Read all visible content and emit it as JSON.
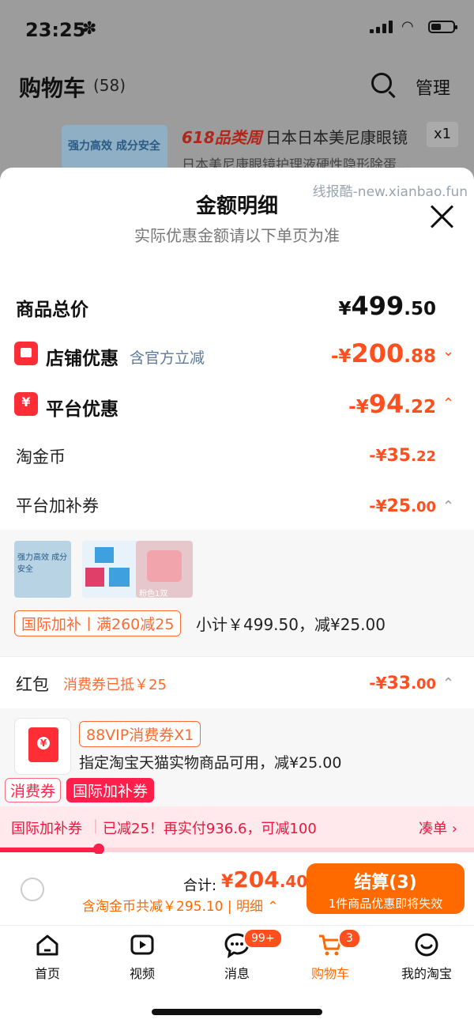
{
  "status": {
    "time": "23:25",
    "flower_icon": "✽"
  },
  "background_page": {
    "title": "购物车",
    "count": "(58)",
    "manage_label": "管理",
    "item_promo": "618品类周",
    "item_name": "日本日本美尼康眼镜",
    "item_name2": "日本美尼康眼镜护理液硬性隐形除蛋...",
    "item_qty": "x1",
    "thumb_text": "强力高效 成分安全"
  },
  "sheet": {
    "watermark": "线报酷-new.xianbao.fun",
    "title": "金额明细",
    "subtitle": "实际优惠金额请以下单页为准",
    "total": {
      "label": "商品总价",
      "currency": "¥",
      "int": "499",
      "dec": ".50"
    },
    "shop_discount": {
      "label": "店铺优惠",
      "note": "含官方立减",
      "prefix": "-¥",
      "int": "200",
      "dec": ".88"
    },
    "platform_discount": {
      "label": "平台优惠",
      "prefix": "-¥",
      "int": "94",
      "dec": ".22"
    },
    "taojinbi": {
      "label": "淘金币",
      "prefix": "-¥",
      "int": "35",
      "dec": ".22"
    },
    "platform_coupon": {
      "label": "平台加补券",
      "prefix": "-¥",
      "int": "25",
      "dec": ".00"
    },
    "thumbs": {
      "t1_text": "强力高效 成分安全",
      "t3_text": "粉色1双"
    },
    "coupon_tag": "国际加补丨满260减25",
    "coupon_subtotal": "小计￥499.50，减¥25.00",
    "red_packet": {
      "label": "红包",
      "note": "消费券已抵￥25",
      "prefix": "-¥",
      "int": "33",
      "dec": ".00"
    },
    "voucher": {
      "tag": "88VIP消费券X1",
      "desc": "指定淘宝天猫实物商品可用，减¥25.00",
      "pill1": "消费券",
      "pill2": "国际加补券"
    },
    "promo_bar": {
      "left": "国际加补券",
      "mid": "已减25！再实付936.6，可减100",
      "right": "凑单",
      "progress_pct": 21
    }
  },
  "checkout": {
    "total_label": "合计:",
    "currency": "¥",
    "total_int": "204",
    "total_dec": ".40",
    "discount_note": "含淘金币共减￥295.10 | 明细",
    "btn_label": "结算(3)",
    "btn_sub": "1件商品优惠即将失效"
  },
  "tabs": [
    {
      "label": "首页",
      "icon": "home-icon"
    },
    {
      "label": "视频",
      "icon": "video-icon"
    },
    {
      "label": "消息",
      "icon": "message-icon",
      "badge": "99+"
    },
    {
      "label": "购物车",
      "icon": "cart-icon",
      "badge": "3"
    },
    {
      "label": "我的淘宝",
      "icon": "profile-icon"
    }
  ],
  "colors": {
    "accent": "#ff4f1f",
    "brand_red": "#ff2e36",
    "checkout": "#ff6a00"
  }
}
